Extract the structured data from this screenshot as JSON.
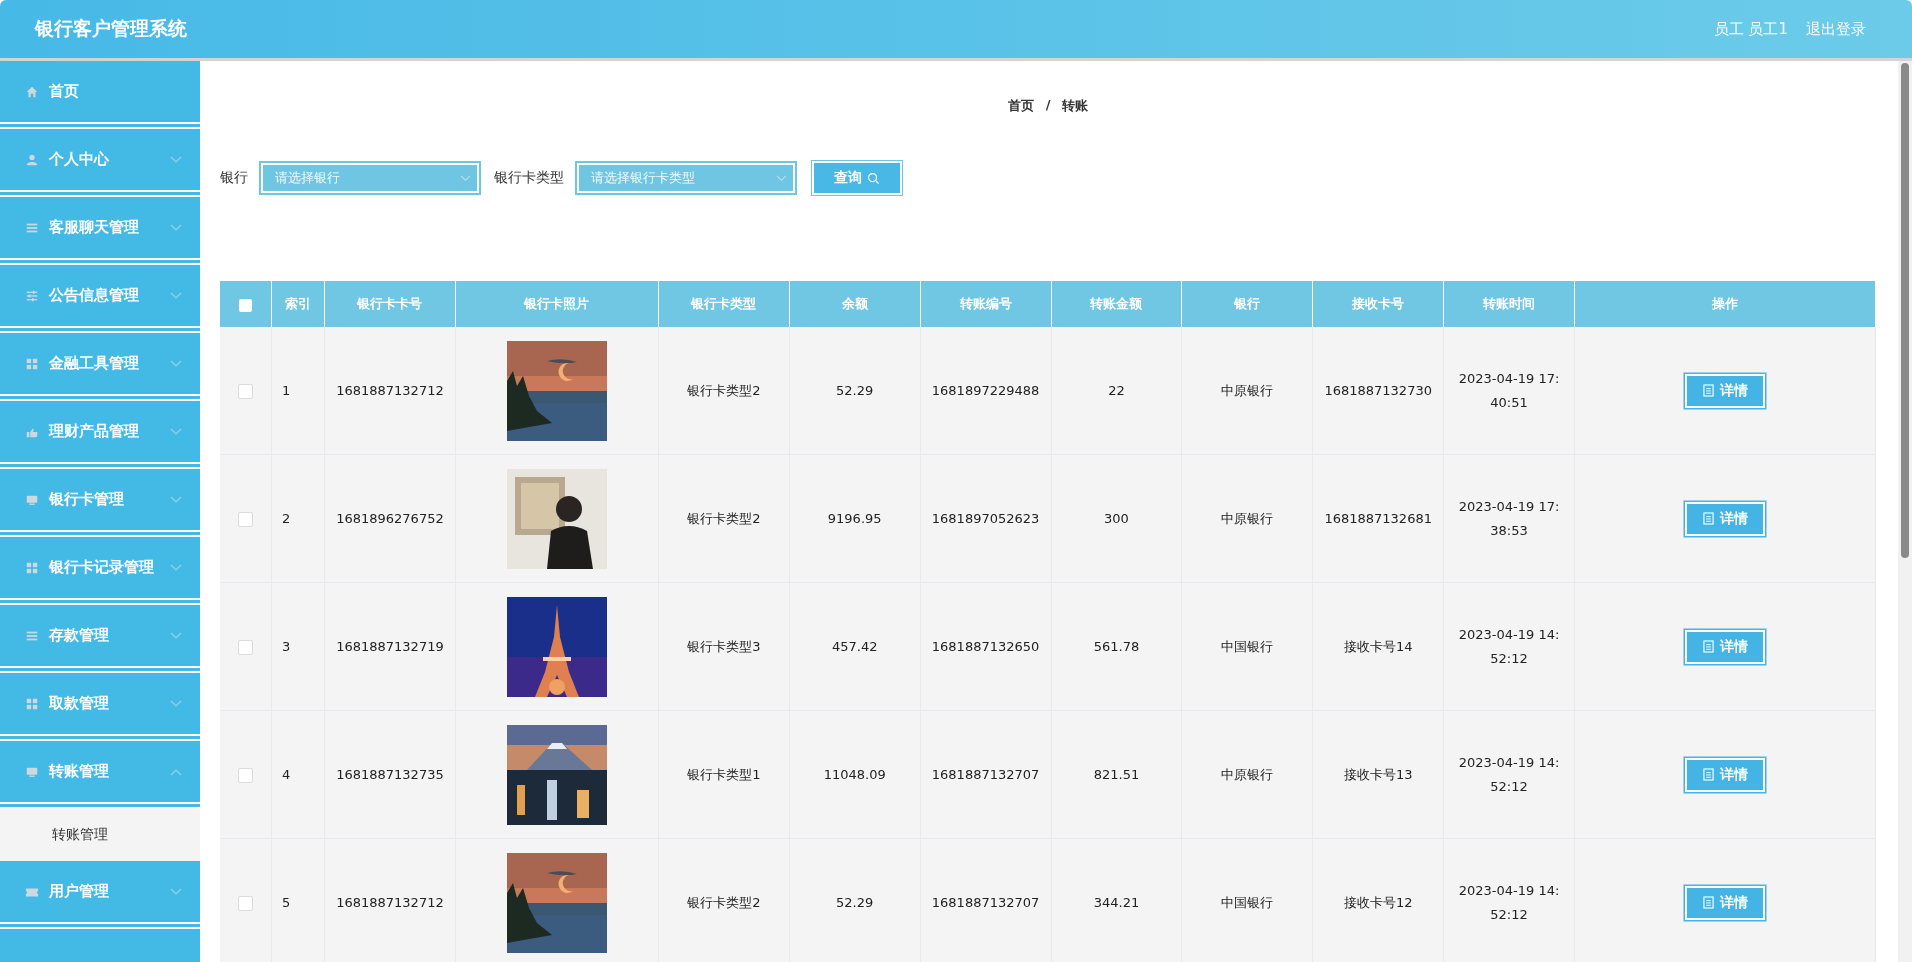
{
  "header": {
    "title": "银行客户管理系统",
    "user": "员工 员工1",
    "logout": "退出登录"
  },
  "sidebar": {
    "items": [
      {
        "label": "首页",
        "selected": false
      },
      {
        "label": "个人中心",
        "selected": false,
        "expanded": false
      },
      {
        "label": "客服聊天管理",
        "selected": false,
        "expanded": false
      },
      {
        "label": "公告信息管理",
        "selected": false,
        "expanded": false
      },
      {
        "label": "金融工具管理",
        "selected": false,
        "expanded": false
      },
      {
        "label": "理财产品管理",
        "selected": false,
        "expanded": false
      },
      {
        "label": "银行卡管理",
        "selected": false,
        "expanded": false
      },
      {
        "label": "银行卡记录管理",
        "selected": false,
        "expanded": false
      },
      {
        "label": "存款管理",
        "selected": false,
        "expanded": false
      },
      {
        "label": "取款管理",
        "selected": false,
        "expanded": false
      },
      {
        "label": "转账管理",
        "selected": false,
        "expanded": true,
        "children": [
          {
            "label": "转账管理",
            "selected": false
          }
        ]
      },
      {
        "label": "用户管理",
        "selected": false,
        "expanded": false
      }
    ]
  },
  "breadcrumb": [
    "首页",
    "转账"
  ],
  "breadcrumb_separator": "/",
  "search": {
    "fields": [
      {
        "label": "银行",
        "placeholder": "请选择银行"
      },
      {
        "label": "银行卡类型",
        "placeholder": "请选择银行卡类型"
      }
    ],
    "button": "查询"
  },
  "table": {
    "columns": [
      "索引",
      "银行卡卡号",
      "银行卡照片",
      "银行卡类型",
      "余额",
      "转账编号",
      "转账金额",
      "银行",
      "接收卡号",
      "转账时间",
      "操作"
    ],
    "header_checked": false,
    "rows": [
      {
        "checked": false,
        "index": "1",
        "card_no": "1681887132712",
        "card_type": "银行卡类型2",
        "balance": "52.29",
        "transfer_no": "1681897229488",
        "amount": "22",
        "bank": "中原银行",
        "receive_no": "1681887132730",
        "time": "2023-04-19 17:40:51",
        "action": "详情"
      },
      {
        "checked": false,
        "index": "2",
        "card_no": "1681896276752",
        "card_type": "银行卡类型2",
        "balance": "9196.95",
        "transfer_no": "1681897052623",
        "amount": "300",
        "bank": "中原银行",
        "receive_no": "1681887132681",
        "time": "2023-04-19 17:38:53",
        "action": "详情"
      },
      {
        "checked": false,
        "index": "3",
        "card_no": "1681887132719",
        "card_type": "银行卡类型3",
        "balance": "457.42",
        "transfer_no": "1681887132650",
        "amount": "561.78",
        "bank": "中国银行",
        "receive_no": "接收卡号14",
        "time": "2023-04-19 14:52:12",
        "action": "详情"
      },
      {
        "checked": false,
        "index": "4",
        "card_no": "1681887132735",
        "card_type": "银行卡类型1",
        "balance": "11048.09",
        "transfer_no": "1681887132707",
        "amount": "821.51",
        "bank": "中原银行",
        "receive_no": "接收卡号13",
        "time": "2023-04-19 14:52:12",
        "action": "详情"
      },
      {
        "checked": false,
        "index": "5",
        "card_no": "1681887132712",
        "card_type": "银行卡类型2",
        "balance": "52.29",
        "transfer_no": "1681887132707",
        "amount": "344.21",
        "bank": "中国银行",
        "receive_no": "接收卡号12",
        "time": "2023-04-19 14:52:12",
        "action": "详情"
      }
    ]
  }
}
